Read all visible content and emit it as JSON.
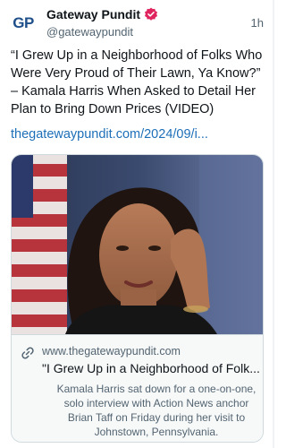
{
  "post": {
    "avatar_text": "GP",
    "display_name": "Gateway Pundit",
    "verified_icon": "verified-badge-icon",
    "handle": "@gatewaypundit",
    "time": "1h",
    "text": "“I Grew Up in a Neighborhood of Folks Who Were Very Proud of Their Lawn, Ya Know?” – Kamala Harris When Asked to Detail Her Plan to Bring Down Prices (VIDEO)",
    "link_text": "thegatewaypundit.com/2024/09/i..."
  },
  "card": {
    "link_icon": "link-icon",
    "domain": "www.thegatewaypundit.com",
    "title": "\"I Grew Up in a Neighborhood of Folk...",
    "description": "Kamala Harris sat down for a one-on-one, solo interview with Action News anchor Brian Taff on Friday during her visit to Johnstown, Pennsylvania."
  },
  "colors": {
    "link": "#1d6fb8",
    "brand": "#1f4f8a",
    "verified": "#e0245e",
    "muted": "#536471",
    "card_border": "#cfd9de"
  }
}
